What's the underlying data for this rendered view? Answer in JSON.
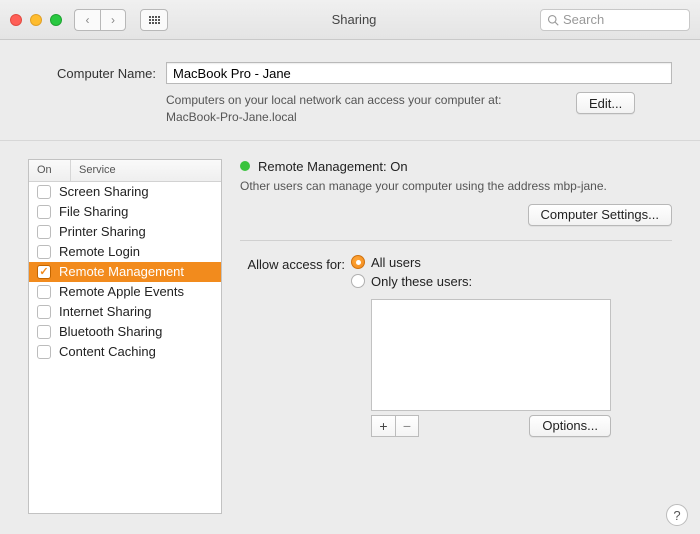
{
  "window": {
    "title": "Sharing",
    "search_placeholder": "Search"
  },
  "computer_name": {
    "label": "Computer Name:",
    "value": "MacBook Pro - Jane",
    "description_line1": "Computers on your local network can access your computer at:",
    "description_line2": "MacBook-Pro-Jane.local",
    "edit_button": "Edit..."
  },
  "sidebar": {
    "header_on": "On",
    "header_service": "Service",
    "items": [
      {
        "label": "Screen Sharing",
        "on": false
      },
      {
        "label": "File Sharing",
        "on": false
      },
      {
        "label": "Printer Sharing",
        "on": false
      },
      {
        "label": "Remote Login",
        "on": false
      },
      {
        "label": "Remote Management",
        "on": true,
        "selected": true
      },
      {
        "label": "Remote Apple Events",
        "on": false
      },
      {
        "label": "Internet Sharing",
        "on": false
      },
      {
        "label": "Bluetooth Sharing",
        "on": false
      },
      {
        "label": "Content Caching",
        "on": false
      }
    ]
  },
  "detail": {
    "status_title": "Remote Management: On",
    "status_desc": "Other users can manage your computer using the address mbp-jane.",
    "computer_settings_button": "Computer Settings...",
    "allow_access_label": "Allow access for:",
    "radio_all": "All users",
    "radio_only": "Only these users:",
    "options_button": "Options..."
  },
  "colors": {
    "accent": "#f28b1d",
    "status_on": "#39c33d"
  }
}
